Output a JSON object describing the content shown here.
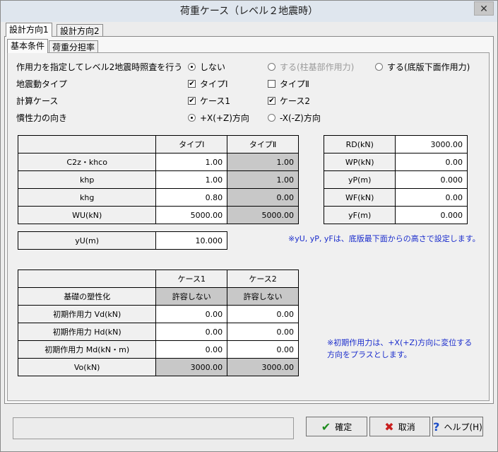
{
  "window": {
    "title": "荷重ケース（レベル２地震時）",
    "close": "✕"
  },
  "tabs_top": [
    "設計方向1",
    "設計方向2"
  ],
  "tabs_sub": [
    "基本条件",
    "荷重分担率"
  ],
  "options": {
    "r1": {
      "label": "作用力を指定してレベル2地震時照査を行う",
      "a": "しない",
      "b": "する(柱基部作用力)",
      "c": "する(底版下面作用力)"
    },
    "r2": {
      "label": "地震動タイプ",
      "a": "タイプⅠ",
      "b": "タイプⅡ"
    },
    "r3": {
      "label": "計算ケース",
      "a": "ケース1",
      "b": "ケース2"
    },
    "r4": {
      "label": "慣性力の向き",
      "a": "+X(+Z)方向",
      "b": "-X(-Z)方向"
    }
  },
  "table1": {
    "headers": [
      "",
      "タイプⅠ",
      "タイプⅡ"
    ],
    "rows": [
      [
        "C2z・khco",
        "1.00",
        "1.00"
      ],
      [
        "khp",
        "1.00",
        "1.00"
      ],
      [
        "khg",
        "0.80",
        "0.00"
      ],
      [
        "WU(kN)",
        "5000.00",
        "5000.00"
      ]
    ]
  },
  "table2": {
    "rows": [
      [
        "RD(kN)",
        "3000.00"
      ],
      [
        "WP(kN)",
        "0.00"
      ],
      [
        "yP(m)",
        "0.000"
      ],
      [
        "WF(kN)",
        "0.00"
      ],
      [
        "yF(m)",
        "0.000"
      ]
    ]
  },
  "yu": {
    "label": "yU(m)",
    "value": "10.000"
  },
  "note1": "※yU, yP, yFは、底版最下面からの高さで設定します。",
  "table3": {
    "headers": [
      "",
      "ケース1",
      "ケース2"
    ],
    "rows": [
      [
        "基礎の塑性化",
        "許容しない",
        "許容しない"
      ],
      [
        "初期作用力 Vd(kN)",
        "0.00",
        "0.00"
      ],
      [
        "初期作用力 Hd(kN)",
        "0.00",
        "0.00"
      ],
      [
        "初期作用力 Md(kN・m)",
        "0.00",
        "0.00"
      ],
      [
        "Vo(kN)",
        "3000.00",
        "3000.00"
      ]
    ]
  },
  "note2": [
    "※初期作用力は、+X(+Z)方向に変位する",
    "方向をプラスとします。"
  ],
  "buttons": {
    "ok": "確定",
    "cancel": "取消",
    "help": "ヘルプ(H)"
  },
  "icons": {
    "ok": "check-icon",
    "cancel": "x-icon",
    "help": "question-icon"
  },
  "colors": {
    "note": "#1a2ccc",
    "gray_cell": "#c8c8c8",
    "ok_icon": "#1e8c1e",
    "cancel_icon": "#c81e1e",
    "help_icon": "#1e4fc8"
  }
}
